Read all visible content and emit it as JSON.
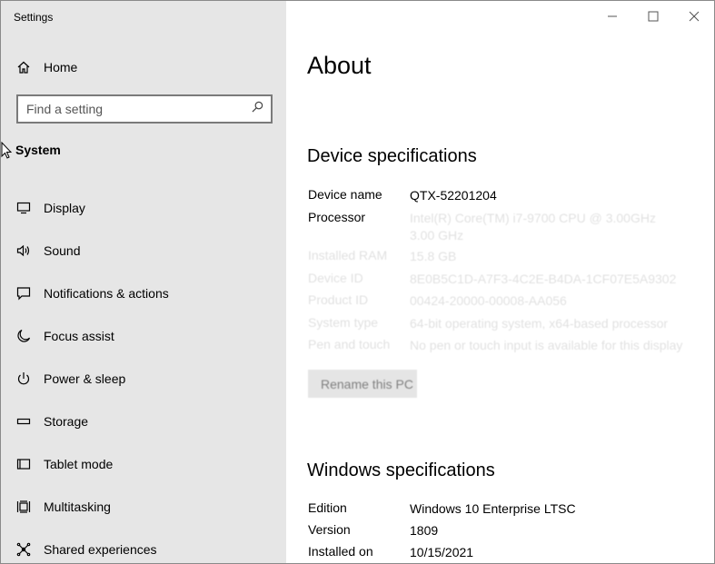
{
  "window": {
    "title": "Settings"
  },
  "sidebar": {
    "home_label": "Home",
    "search_placeholder": "Find a setting",
    "section_title": "System",
    "items": [
      {
        "label": "Display",
        "icon": "monitor-icon"
      },
      {
        "label": "Sound",
        "icon": "speaker-icon"
      },
      {
        "label": "Notifications & actions",
        "icon": "notification-icon"
      },
      {
        "label": "Focus assist",
        "icon": "moon-icon"
      },
      {
        "label": "Power & sleep",
        "icon": "power-icon"
      },
      {
        "label": "Storage",
        "icon": "storage-icon"
      },
      {
        "label": "Tablet mode",
        "icon": "tablet-icon"
      },
      {
        "label": "Multitasking",
        "icon": "multitasking-icon"
      },
      {
        "label": "Shared experiences",
        "icon": "shared-icon"
      }
    ]
  },
  "main": {
    "title": "About",
    "device_specs": {
      "heading": "Device specifications",
      "rows": [
        {
          "key": "Device name",
          "value": "QTX-52201204"
        },
        {
          "key": "Processor",
          "value": "Intel(R) Core(TM) i7-9700 CPU @ 3.00GHz   3.00 GHz"
        },
        {
          "key": "Installed RAM",
          "value": "15.8 GB"
        },
        {
          "key": "Device ID",
          "value": "8E0B5C1D-A7F3-4C2E-B4DA-1CF07E5A9302"
        },
        {
          "key": "Product ID",
          "value": "00424-20000-00008-AA056"
        },
        {
          "key": "System type",
          "value": "64-bit operating system, x64-based processor"
        },
        {
          "key": "Pen and touch",
          "value": "No pen or touch input is available for this display"
        }
      ],
      "rename_button": "Rename this PC"
    },
    "windows_specs": {
      "heading": "Windows specifications",
      "rows": [
        {
          "key": "Edition",
          "value": "Windows 10 Enterprise LTSC"
        },
        {
          "key": "Version",
          "value": "1809"
        },
        {
          "key": "Installed on",
          "value": "10/15/2021"
        }
      ]
    }
  },
  "colors": {
    "sidebar_bg": "#e6e6e6",
    "rename_button_bg": "#cccccc"
  }
}
